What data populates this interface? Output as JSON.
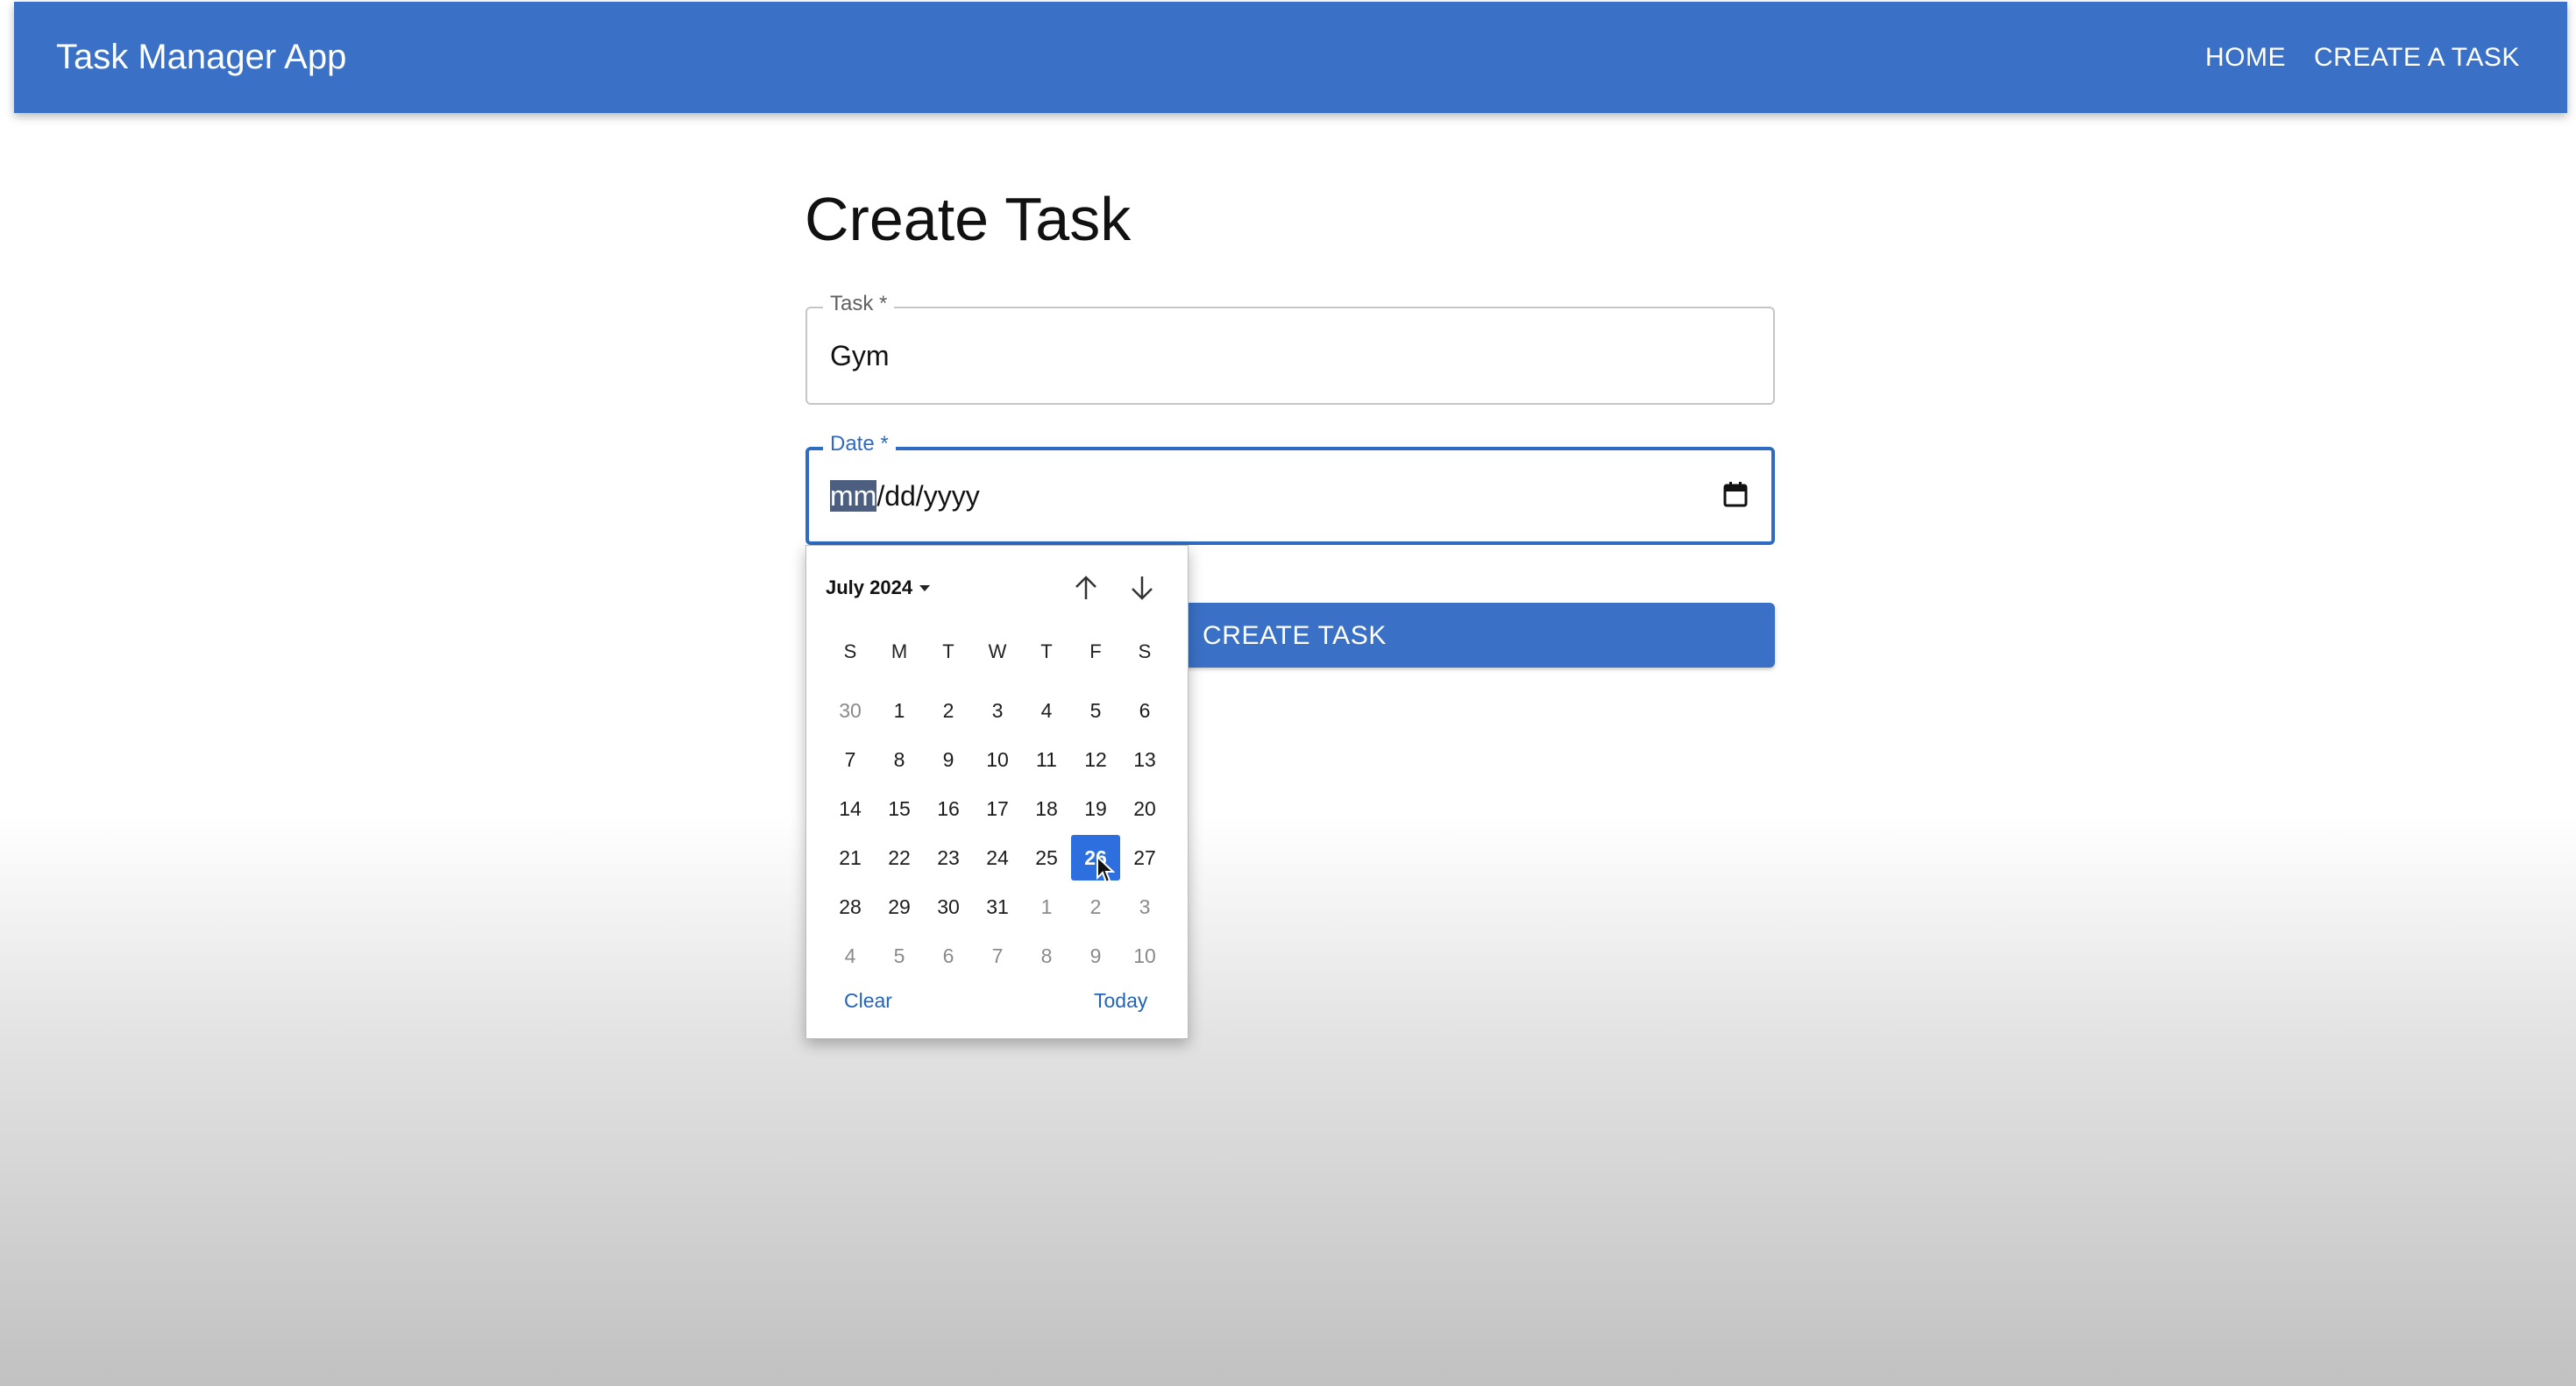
{
  "header": {
    "app_title": "Task Manager App",
    "nav": [
      {
        "label": "HOME"
      },
      {
        "label": "CREATE A TASK"
      }
    ]
  },
  "main": {
    "page_title": "Create Task",
    "task_field": {
      "label": "Task *",
      "value": "Gym"
    },
    "date_field": {
      "label": "Date *",
      "segment_month": "mm",
      "segment_rest": "/dd/yyyy",
      "icon": "calendar-icon"
    },
    "submit_label": "CREATE TASK"
  },
  "datepicker": {
    "month_label": "July 2024",
    "weekdays": [
      "S",
      "M",
      "T",
      "W",
      "T",
      "F",
      "S"
    ],
    "weeks": [
      [
        {
          "d": "30",
          "other": true
        },
        {
          "d": "1"
        },
        {
          "d": "2"
        },
        {
          "d": "3"
        },
        {
          "d": "4"
        },
        {
          "d": "5"
        },
        {
          "d": "6"
        }
      ],
      [
        {
          "d": "7"
        },
        {
          "d": "8"
        },
        {
          "d": "9"
        },
        {
          "d": "10"
        },
        {
          "d": "11"
        },
        {
          "d": "12"
        },
        {
          "d": "13"
        }
      ],
      [
        {
          "d": "14"
        },
        {
          "d": "15"
        },
        {
          "d": "16"
        },
        {
          "d": "17"
        },
        {
          "d": "18"
        },
        {
          "d": "19"
        },
        {
          "d": "20"
        }
      ],
      [
        {
          "d": "21"
        },
        {
          "d": "22"
        },
        {
          "d": "23"
        },
        {
          "d": "24"
        },
        {
          "d": "25"
        },
        {
          "d": "26",
          "selected": true
        },
        {
          "d": "27"
        }
      ],
      [
        {
          "d": "28"
        },
        {
          "d": "29"
        },
        {
          "d": "30"
        },
        {
          "d": "31"
        },
        {
          "d": "1",
          "other": true
        },
        {
          "d": "2",
          "other": true
        },
        {
          "d": "3",
          "other": true
        }
      ],
      [
        {
          "d": "4",
          "other": true
        },
        {
          "d": "5",
          "other": true
        },
        {
          "d": "6",
          "other": true
        },
        {
          "d": "7",
          "other": true
        },
        {
          "d": "8",
          "other": true
        },
        {
          "d": "9",
          "other": true
        },
        {
          "d": "10",
          "other": true
        }
      ]
    ],
    "clear_label": "Clear",
    "today_label": "Today"
  },
  "colors": {
    "appbar": "#3a71c6",
    "focus": "#2f6bc2",
    "selected_day": "#2e6fe0",
    "link": "#2464b8"
  }
}
